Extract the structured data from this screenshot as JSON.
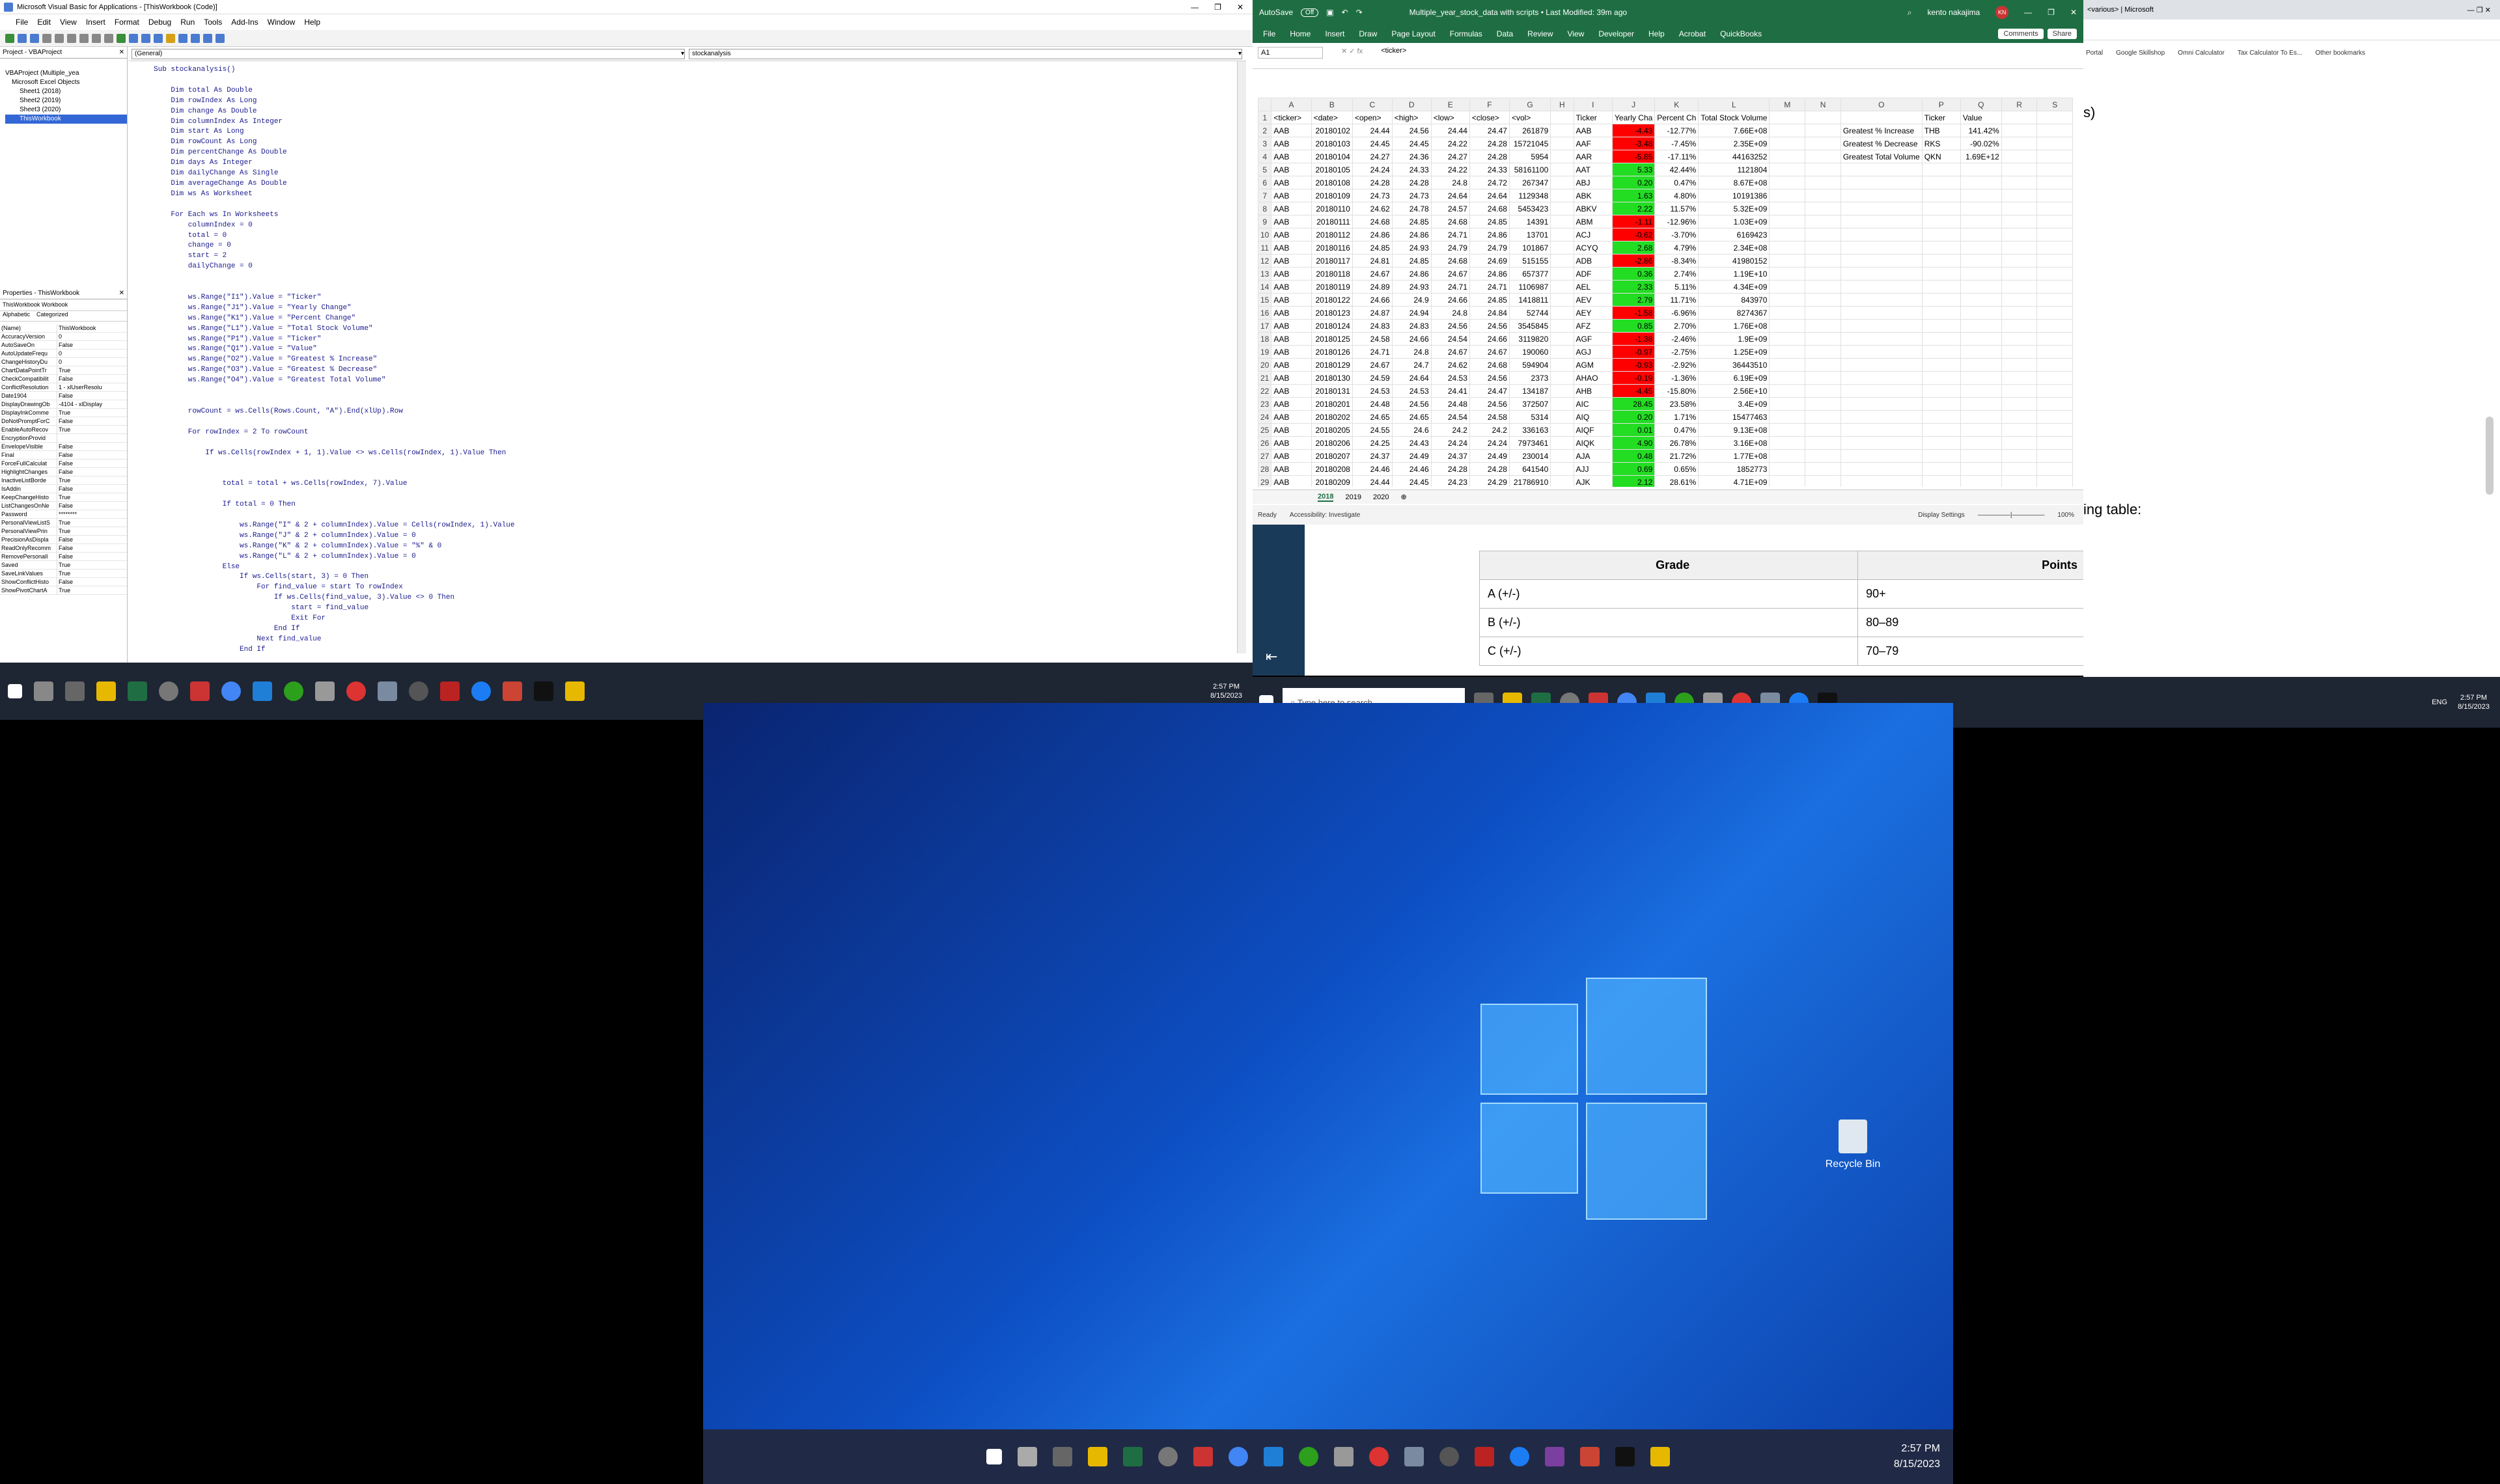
{
  "vbe": {
    "title": "Microsoft Visual Basic for Applications - [ThisWorkbook (Code)]",
    "menu": [
      "File",
      "Edit",
      "View",
      "Insert",
      "Format",
      "Debug",
      "Run",
      "Tools",
      "Add-Ins",
      "Window",
      "Help"
    ],
    "project_title": "Project - VBAProject",
    "tree": [
      "VBAProject (Multiple_yea",
      "Microsoft Excel Objects",
      "Sheet1 (2018)",
      "Sheet2 (2019)",
      "Sheet3 (2020)",
      "ThisWorkbook"
    ],
    "props_title": "Properties - ThisWorkbook",
    "props_object": "ThisWorkbook  Workbook",
    "props_tabs": [
      "Alphabetic",
      "Categorized"
    ],
    "props": [
      [
        "(Name)",
        "ThisWorkbook"
      ],
      [
        "AccuracyVersion",
        "0"
      ],
      [
        "AutoSaveOn",
        "False"
      ],
      [
        "AutoUpdateFrequ",
        "0"
      ],
      [
        "ChangeHistoryDu",
        "0"
      ],
      [
        "ChartDataPointTr",
        "True"
      ],
      [
        "CheckCompatibilit",
        "False"
      ],
      [
        "ConflictResolution",
        "1 - xlUserResolu"
      ],
      [
        "Date1904",
        "False"
      ],
      [
        "DisplayDrawingOb",
        "-4104 - xlDisplay"
      ],
      [
        "DisplayInkComme",
        "True"
      ],
      [
        "DoNotPromptForC",
        "False"
      ],
      [
        "EnableAutoRecov",
        "True"
      ],
      [
        "EncryptionProvid",
        ""
      ],
      [
        "EnvelopeVisible",
        "False"
      ],
      [
        "Final",
        "False"
      ],
      [
        "ForceFullCalculat",
        "False"
      ],
      [
        "HighlightChanges",
        "False"
      ],
      [
        "InactiveListBorde",
        "True"
      ],
      [
        "IsAddin",
        "False"
      ],
      [
        "KeepChangeHisto",
        "True"
      ],
      [
        "ListChangesOnNe",
        "False"
      ],
      [
        "Password",
        "********"
      ],
      [
        "PersonalViewListS",
        "True"
      ],
      [
        "PersonalViewPrin",
        "True"
      ],
      [
        "PrecisionAsDispla",
        "False"
      ],
      [
        "ReadOnlyRecomm",
        "False"
      ],
      [
        "RemovePersonalI",
        "False"
      ],
      [
        "Saved",
        "True"
      ],
      [
        "SaveLinkValues",
        "True"
      ],
      [
        "ShowConflictHisto",
        "False"
      ],
      [
        "ShowPivotChartA",
        "True"
      ]
    ],
    "combo_general": "(General)",
    "combo_proc": "stockanalysis",
    "code": "Sub stockanalysis()\n\n    Dim total As Double\n    Dim rowIndex As Long\n    Dim change As Double\n    Dim columnIndex As Integer\n    Dim start As Long\n    Dim rowCount As Long\n    Dim percentChange As Double\n    Dim days As Integer\n    Dim dailyChange As Single\n    Dim averageChange As Double\n    Dim ws As Worksheet\n\n    For Each ws In Worksheets\n        columnIndex = 0\n        total = 0\n        change = 0\n        start = 2\n        dailyChange = 0\n\n\n        ws.Range(\"I1\").Value = \"Ticker\"\n        ws.Range(\"J1\").Value = \"Yearly Change\"\n        ws.Range(\"K1\").Value = \"Percent Change\"\n        ws.Range(\"L1\").Value = \"Total Stock Volume\"\n        ws.Range(\"P1\").Value = \"Ticker\"\n        ws.Range(\"Q1\").Value = \"Value\"\n        ws.Range(\"O2\").Value = \"Greatest % Increase\"\n        ws.Range(\"O3\").Value = \"Greatest % Decrease\"\n        ws.Range(\"O4\").Value = \"Greatest Total Volume\"\n\n\n        rowCount = ws.Cells(Rows.Count, \"A\").End(xlUp).Row\n\n        For rowIndex = 2 To rowCount\n\n            If ws.Cells(rowIndex + 1, 1).Value <> ws.Cells(rowIndex, 1).Value Then\n\n\n                total = total + ws.Cells(rowIndex, 7).Value\n\n                If total = 0 Then\n\n                    ws.Range(\"I\" & 2 + columnIndex).Value = Cells(rowIndex, 1).Value\n                    ws.Range(\"J\" & 2 + columnIndex).Value = 0\n                    ws.Range(\"K\" & 2 + columnIndex).Value = \"%\" & 0\n                    ws.Range(\"L\" & 2 + columnIndex).Value = 0\n                Else\n                    If ws.Cells(start, 3) = 0 Then\n                        For find_value = start To rowIndex\n                            If ws.Cells(find_value, 3).Value <> 0 Then\n                                start = find_value\n                                Exit For\n                            End If\n                        Next find_value\n                    End If"
  },
  "taskbar_left": {
    "time": "2:57 PM",
    "date": "8/15/2023"
  },
  "excel": {
    "autosave": "AutoSave",
    "autosave_state": "Off",
    "filename": "Multiple_year_stock_data with scripts • Last Modified: 39m ago",
    "user": "kento nakajima",
    "user_initials": "KN",
    "menu": [
      "File",
      "Home",
      "Insert",
      "Draw",
      "Page Layout",
      "Formulas",
      "Data",
      "Review",
      "View",
      "Developer",
      "Help",
      "Acrobat",
      "QuickBooks"
    ],
    "comments_label": "Comments",
    "share_label": "Share",
    "namebox": "A1",
    "formula": "<ticker>",
    "col_headers": [
      "A",
      "B",
      "C",
      "D",
      "E",
      "F",
      "G",
      "H",
      "I",
      "J",
      "K",
      "L",
      "M",
      "N",
      "O",
      "P",
      "Q",
      "R",
      "S"
    ],
    "header_row": [
      "<ticker>",
      "<date>",
      "<open>",
      "<high>",
      "<low>",
      "<close>",
      "<vol>",
      "",
      "Ticker",
      "Yearly Cha",
      "Percent Ch",
      "Total Stock Volume",
      "",
      "",
      "",
      "Ticker",
      "Value",
      "",
      ""
    ],
    "rows": [
      [
        "AAB",
        "20180102",
        "24.44",
        "24.56",
        "24.44",
        "24.47",
        "261879",
        "",
        "AAB",
        "-4.43",
        "-12.77%",
        "7.66E+08"
      ],
      [
        "AAB",
        "20180103",
        "24.45",
        "24.45",
        "24.22",
        "24.28",
        "15721045",
        "",
        "AAF",
        "-3.48",
        "-7.45%",
        "2.35E+09"
      ],
      [
        "AAB",
        "20180104",
        "24.27",
        "24.36",
        "24.27",
        "24.28",
        "5954",
        "",
        "AAR",
        "-5.85",
        "-17.11%",
        "44163252"
      ],
      [
        "AAB",
        "20180105",
        "24.24",
        "24.33",
        "24.22",
        "24.33",
        "58161100",
        "",
        "AAT",
        "5.33",
        "42.44%",
        "1121804"
      ],
      [
        "AAB",
        "20180108",
        "24.28",
        "24.28",
        "24.8",
        "24.72",
        "267347",
        "",
        "ABJ",
        "0.20",
        "0.47%",
        "8.67E+08"
      ],
      [
        "AAB",
        "20180109",
        "24.73",
        "24.73",
        "24.64",
        "24.64",
        "1129348",
        "",
        "ABK",
        "1.63",
        "4.80%",
        "10191386"
      ],
      [
        "AAB",
        "20180110",
        "24.62",
        "24.78",
        "24.57",
        "24.68",
        "5453423",
        "",
        "ABKV",
        "2.22",
        "11.57%",
        "5.32E+09"
      ],
      [
        "AAB",
        "20180111",
        "24.68",
        "24.85",
        "24.68",
        "24.85",
        "14391",
        "",
        "ABM",
        "-1.11",
        "-12.96%",
        "1.03E+09"
      ],
      [
        "AAB",
        "20180112",
        "24.86",
        "24.86",
        "24.71",
        "24.86",
        "13701",
        "",
        "ACJ",
        "-0.62",
        "-3.70%",
        "6169423"
      ],
      [
        "AAB",
        "20180116",
        "24.85",
        "24.93",
        "24.79",
        "24.79",
        "101867",
        "",
        "ACYQ",
        "2.68",
        "4.79%",
        "2.34E+08"
      ],
      [
        "AAB",
        "20180117",
        "24.81",
        "24.85",
        "24.68",
        "24.69",
        "515155",
        "",
        "ADB",
        "-2.86",
        "-8.34%",
        "41980152"
      ],
      [
        "AAB",
        "20180118",
        "24.67",
        "24.86",
        "24.67",
        "24.86",
        "657377",
        "",
        "ADF",
        "0.36",
        "2.74%",
        "1.19E+10"
      ],
      [
        "AAB",
        "20180119",
        "24.89",
        "24.93",
        "24.71",
        "24.71",
        "1106987",
        "",
        "AEL",
        "2.33",
        "5.11%",
        "4.34E+09"
      ],
      [
        "AAB",
        "20180122",
        "24.66",
        "24.9",
        "24.66",
        "24.85",
        "1418811",
        "",
        "AEV",
        "2.79",
        "11.71%",
        "843970"
      ],
      [
        "AAB",
        "20180123",
        "24.87",
        "24.94",
        "24.8",
        "24.84",
        "52744",
        "",
        "AEY",
        "-1.58",
        "-6.96%",
        "8274367"
      ],
      [
        "AAB",
        "20180124",
        "24.83",
        "24.83",
        "24.56",
        "24.56",
        "3545845",
        "",
        "AFZ",
        "0.85",
        "2.70%",
        "1.76E+08"
      ],
      [
        "AAB",
        "20180125",
        "24.58",
        "24.66",
        "24.54",
        "24.66",
        "3119820",
        "",
        "AGF",
        "-1.38",
        "-2.46%",
        "1.9E+09"
      ],
      [
        "AAB",
        "20180126",
        "24.71",
        "24.8",
        "24.67",
        "24.67",
        "190060",
        "",
        "AGJ",
        "-0.97",
        "-2.75%",
        "1.25E+09"
      ],
      [
        "AAB",
        "20180129",
        "24.67",
        "24.7",
        "24.62",
        "24.68",
        "594904",
        "",
        "AGM",
        "-0.93",
        "-2.92%",
        "36443510"
      ],
      [
        "AAB",
        "20180130",
        "24.59",
        "24.64",
        "24.53",
        "24.56",
        "2373",
        "",
        "AHAO",
        "-0.19",
        "-1.36%",
        "6.19E+09"
      ],
      [
        "AAB",
        "20180131",
        "24.53",
        "24.53",
        "24.41",
        "24.47",
        "134187",
        "",
        "AHB",
        "-4.45",
        "-15.80%",
        "2.56E+10"
      ],
      [
        "AAB",
        "20180201",
        "24.48",
        "24.56",
        "24.48",
        "24.56",
        "372507",
        "",
        "AIC",
        "28.45",
        "23.58%",
        "3.4E+09"
      ],
      [
        "AAB",
        "20180202",
        "24.65",
        "24.65",
        "24.54",
        "24.58",
        "5314",
        "",
        "AIQ",
        "0.20",
        "1.71%",
        "15477463"
      ],
      [
        "AAB",
        "20180205",
        "24.55",
        "24.6",
        "24.2",
        "24.2",
        "336163",
        "",
        "AIQF",
        "0.01",
        "0.47%",
        "9.13E+08"
      ],
      [
        "AAB",
        "20180206",
        "24.25",
        "24.43",
        "24.24",
        "24.24",
        "7973461",
        "",
        "AIQK",
        "4.90",
        "26.78%",
        "3.16E+08"
      ],
      [
        "AAB",
        "20180207",
        "24.37",
        "24.49",
        "24.37",
        "24.49",
        "230014",
        "",
        "AJA",
        "0.48",
        "21.72%",
        "1.77E+08"
      ],
      [
        "AAB",
        "20180208",
        "24.46",
        "24.46",
        "24.28",
        "24.28",
        "641540",
        "",
        "AJJ",
        "0.69",
        "0.65%",
        "1852773"
      ],
      [
        "AAB",
        "20180209",
        "24.44",
        "24.45",
        "24.23",
        "24.29",
        "21786910",
        "",
        "AJK",
        "2.12",
        "28.61%",
        "4.71E+09"
      ]
    ],
    "summary": [
      [
        "Greatest % Increase",
        "THB",
        "141.42%"
      ],
      [
        "Greatest % Decrease",
        "RKS",
        "-90.02%"
      ],
      [
        "Greatest Total Volume",
        "QKN",
        "1.69E+12"
      ]
    ],
    "sheet_tabs": [
      "2018",
      "2019",
      "2020"
    ],
    "status_ready": "Ready",
    "status_access": "Accessibility: Investigate",
    "display_settings": "Display Settings",
    "zoom": "100%"
  },
  "browser": {
    "tabs": [
      "<various> | Microsoft"
    ],
    "bookmarks": [
      "Portal",
      "Google Skillshop",
      "Omni Calculator",
      "Tax Calculator To Es...",
      "Other bookmarks"
    ],
    "fragment": "ing table:",
    "grade_headers": [
      "Grade",
      "Points"
    ],
    "grades": [
      [
        "A (+/-)",
        "90+"
      ],
      [
        "B (+/-)",
        "80–89"
      ],
      [
        "C (+/-)",
        "70–79"
      ]
    ]
  },
  "taskbar_right": {
    "search_placeholder": "Type here to search",
    "lang": "ENG",
    "time": "2:57 PM",
    "date": "8/15/2023"
  },
  "desktop": {
    "recycle_bin": "Recycle Bin",
    "time": "2:57 PM",
    "date": "8/15/2023"
  }
}
